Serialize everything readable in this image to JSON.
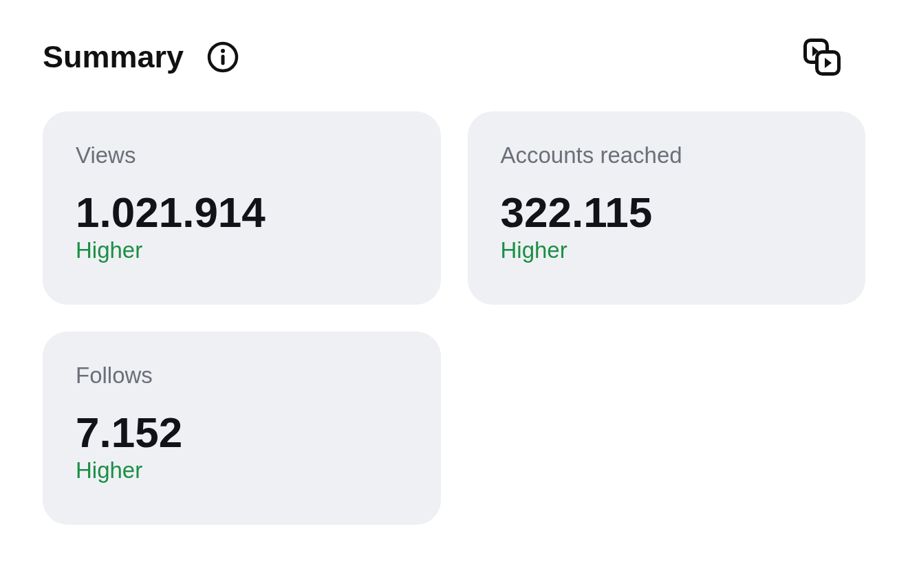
{
  "header": {
    "title": "Summary"
  },
  "cards": [
    {
      "label": "Views",
      "value": "1.021.914",
      "comparison": "Higher"
    },
    {
      "label": "Accounts reached",
      "value": "322.115",
      "comparison": "Higher"
    },
    {
      "label": "Follows",
      "value": "7.152",
      "comparison": "Higher"
    }
  ]
}
